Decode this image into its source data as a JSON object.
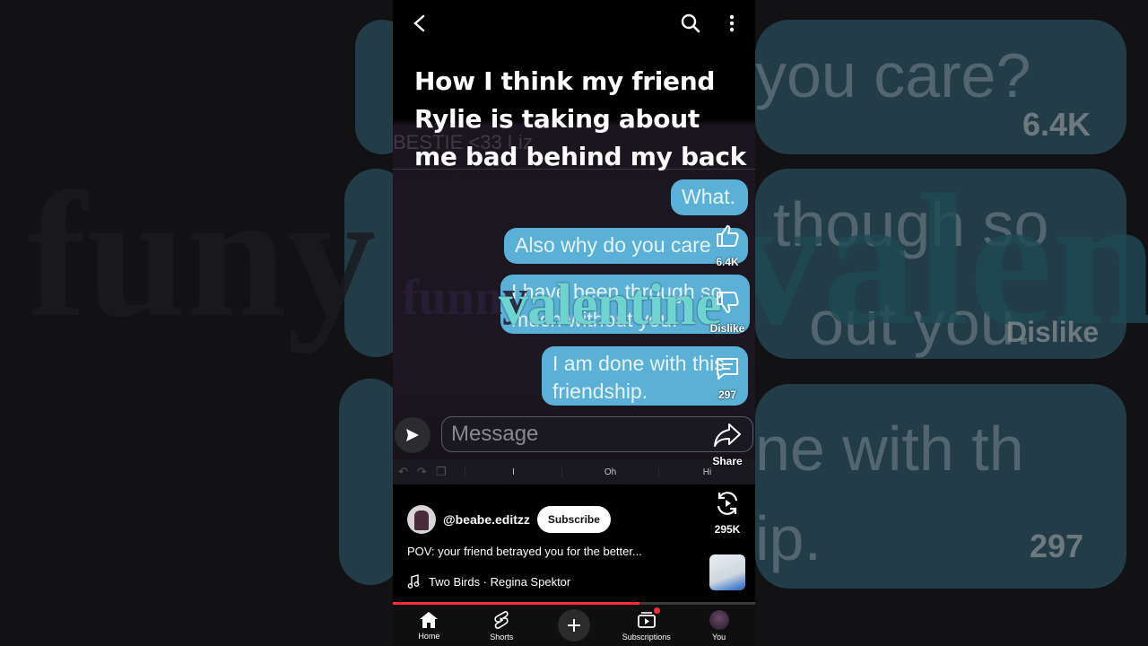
{
  "caption": "How I think my friend Rylie is taking about me bad behind my back",
  "chat": {
    "contact_header": "BESTIE <33 Liz",
    "messages": [
      "What.",
      "Also why do you care",
      "I have been through so much without you.",
      "I am done with this friendship."
    ],
    "input_placeholder": "Message",
    "keyboard_suggestions": [
      "I",
      "Oh",
      "Hi"
    ]
  },
  "watermark": {
    "dark": "funny",
    "light": "valentine"
  },
  "background": {
    "side_texts_right": [
      "you care?",
      "though so",
      "out you.",
      "ne with th",
      "ip."
    ],
    "side_counts": [
      "6.4K",
      "Dislike",
      "297"
    ],
    "left_watermark": "funy"
  },
  "actions": {
    "like": "6.4K",
    "dislike": "Dislike",
    "comments": "297",
    "share": "Share",
    "remix": "295K"
  },
  "channel": {
    "handle": "@beabe.editzz",
    "subscribe_label": "Subscribe"
  },
  "description": "POV: your friend betrayed you for the better...",
  "music": "Two Birds · Regina Spektor",
  "progress": 0.68,
  "nav": {
    "home": "Home",
    "shorts": "Shorts",
    "subscriptions": "Subscriptions",
    "you": "You"
  },
  "colors": {
    "bubble": "#5ab0d6",
    "accent": "#ff2b3a"
  }
}
